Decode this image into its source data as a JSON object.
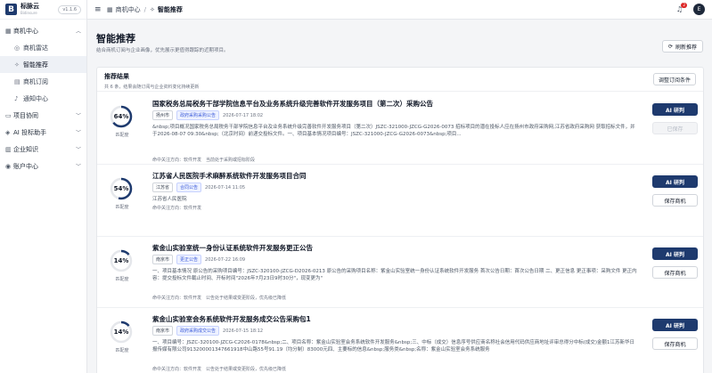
{
  "brand": {
    "logo": "B",
    "name": "标脉云",
    "sub": "Bidinsure",
    "version": "v1.1.6"
  },
  "sidebar": {
    "groups": [
      {
        "label": "商机中心",
        "icon": "grid-icon",
        "expanded": true
      },
      {
        "label": "项目协同",
        "icon": "folder-icon"
      },
      {
        "label": "AI 投标助手",
        "icon": "chip-icon"
      },
      {
        "label": "企业知识",
        "icon": "book-icon"
      },
      {
        "label": "账户中心",
        "icon": "user-icon"
      }
    ],
    "items": [
      {
        "label": "商机雷达",
        "icon": "radar-icon"
      },
      {
        "label": "智能推荐",
        "icon": "sparkle-icon",
        "active": true
      },
      {
        "label": "商机订阅",
        "icon": "subscribe-icon"
      },
      {
        "label": "通知中心",
        "icon": "bell-icon"
      }
    ]
  },
  "topbar": {
    "crumbs": [
      "商机中心",
      "智能推荐"
    ],
    "notification_count": "2",
    "avatar": "E"
  },
  "page": {
    "title": "智能推荐",
    "description": "结合商机订阅与企业画像，优先展示更值得跟踪的近期项目。",
    "refresh_label": "刷新推荐"
  },
  "panel": {
    "title": "推荐结果",
    "subtitle": "共 6 条，结果会随订阅与企业资料变化持续更新",
    "adjust_label": "调整订阅条件"
  },
  "score_label": "匹配度",
  "cards": [
    {
      "score": "64%",
      "score_value": 0.64,
      "title": "国家税务总局税务干部学院信息平台及业务系统升级完善软件开发服务项目（第二次）采购公告",
      "region": "扬州市",
      "category": "政府采购采购公告",
      "date": "2026-07-17 18:02",
      "snippet": "&nbsp;项目概况国家税务总局税务干部学院信息平台及业务系统升级完善软件开发服务项目（第二次）JSZC-321000-JZCG-G2026-0073 招标项目的潜在投标人应在扬州市政府采购网,江苏省政府采购网 获取招标文件，并于2026-08-07 09:30&nbsp;（北京时间）前递交投标文件。一、项目基本情况项目编号：JSZC-321000-JZCG-G2026-0073&nbsp;项目...",
      "meta": [
        "命中关注方向：软件开发",
        "当前处于采购或招标阶段"
      ],
      "primary": "AI 研判",
      "secondary": "已保存",
      "secondary_disabled": true
    },
    {
      "score": "54%",
      "score_value": 0.54,
      "title": "江苏省人民医院手术麻醉系统软件开发服务项目合同",
      "region": "江苏省",
      "category": "合同公告",
      "date": "2026-07-14 11:05",
      "snippet": "江苏省人民医院",
      "meta": [
        "命中关注方向：软件开发"
      ],
      "primary": "AI 研判",
      "secondary": "保存商机",
      "secondary_disabled": false
    },
    {
      "score": "14%",
      "score_value": 0.14,
      "title": "紫金山实验室统一身份认证系统软件开发服务更正公告",
      "region": "南京市",
      "category": "更正公告",
      "date": "2026-07-22 16:09",
      "snippet": "一、项目基本情况 原公告的采购项目编号：JSZC-320100-JZCG-D2026-0213 原公告的采购项目名称：紫金山实验室统一身份认证系统软件开发服务 首次公告日期：首次公告日期 二、更正信息 更正事项：采购文件 更正内容：提交投标文件截止时间、开标时间\"2026年7月23日9时30分\"，现变更为\"",
      "meta": [
        "命中关注方向：软件开发",
        "公告处于结果或变更阶段，优先级已降低"
      ],
      "primary": "AI 研判",
      "secondary": "保存商机",
      "secondary_disabled": false
    },
    {
      "score": "14%",
      "score_value": 0.14,
      "title": "紫金山实验室会务系统软件开发服务成交公告采购包1",
      "region": "南京市",
      "category": "政府采购成交公告",
      "date": "2026-07-15 18:12",
      "snippet": "一、项目编号：JSZC-320100-JZCG-C2026-0178&nbsp;二、项目名称：紫金山实验室会务系统软件开发服务&nbsp;三、中标（成交）信息序号供应商名称社会信用代码供应商地址评审总得分中标(成交)金额1江苏新华日报传媒有限公司913200001347661918中山路55号91.19（均分制）83000元四、主要标的信息&nbsp;服务类&nbsp;名称：紫金山实验室会务系统服务",
      "meta": [
        "命中关注方向：软件开发",
        "公告处于结果或变更阶段，优先级已降低"
      ],
      "primary": "AI 研判",
      "secondary": "保存商机",
      "secondary_disabled": false
    }
  ],
  "colors": {
    "accent": "#1e3a6e",
    "ring_track": "#e5e7eb",
    "ring_fill": "#1e3a6e",
    "tag_blue": "#3b5bdb"
  }
}
